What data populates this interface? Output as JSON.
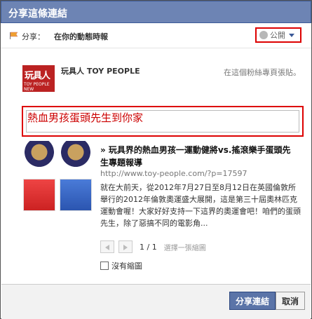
{
  "dialog": {
    "title": "分享這條連結",
    "share_label": "分享：",
    "share_target": "在你的動態時報",
    "privacy": "公開"
  },
  "page": {
    "logo_title": "玩具人",
    "logo_sub": "TOY PEOPLE NEW",
    "name": "玩具人 TOY PEOPLE",
    "post_to": "在這個粉絲專頁張貼。"
  },
  "message": {
    "text": "熱血男孩蛋頭先生到你家"
  },
  "link": {
    "title": "» 玩具界的熱血男孩一運動健將vs.搖滾樂手蛋頭先生專題報導",
    "url": "http://www.toy-people.com/?p=17597",
    "description": "就在大前天，從2012年7月27日至8月12日在英國倫敦所舉行的2012年倫敦奧運盛大展開，這是第三十屆奧林匹克運動會喔！大家好好支持一下這界的奧運會吧！咱們的蛋頭先生，除了惡搞不同的電影角..."
  },
  "thumbnail_pager": {
    "count": "1 / 1",
    "choose": "選擇一張縮圖",
    "no_thumb": "沒有縮圖"
  },
  "footer": {
    "share_button": "分享連結",
    "cancel_button": "取消"
  }
}
